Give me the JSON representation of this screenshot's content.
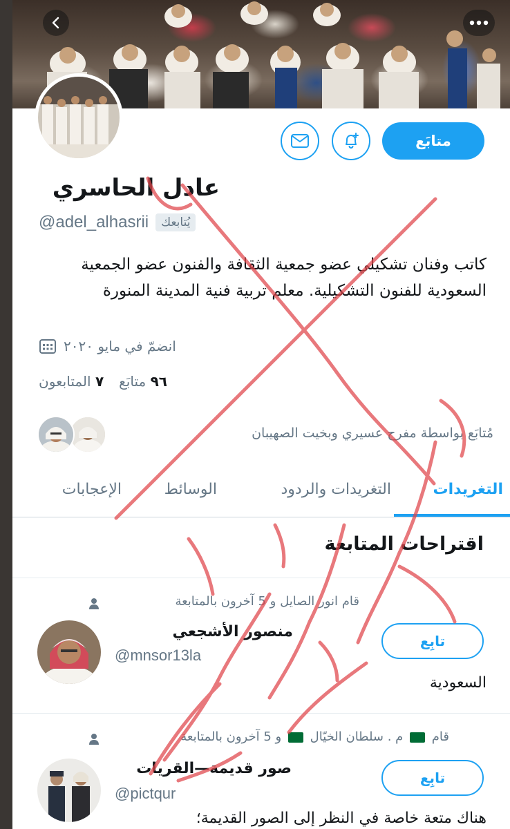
{
  "header": {
    "back_icon": "chevron-left-icon",
    "more_icon": "more-horizontal-icon"
  },
  "profile": {
    "name": "عادل الحاسري",
    "handle": "@adel_alhasrii",
    "follows_you_badge": "يُتابعك",
    "bio": "كاتب وفنان تشكيلي عضو جمعية الثقافة والفنون عضو الجمعية السعودية للفنون التشكيلية. معلم تربية فنية المدينة المنورة",
    "joined": "انضمّ في مايو ٢٠٢٠",
    "following_count": "٩٦",
    "following_label": "متابَع",
    "followers_count": "٧",
    "followers_label": "المتابعون",
    "followed_by": "مُتابَع بواسطة مفرح عسيري وبخيت الصهيبان",
    "follow_button": "متابَع"
  },
  "tabs": [
    {
      "label": "التغريدات",
      "active": true
    },
    {
      "label": "التغريدات والردود",
      "active": false
    },
    {
      "label": "الوسائط",
      "active": false
    },
    {
      "label": "الإعجابات",
      "active": false
    }
  ],
  "suggestions": {
    "title": "اقتراحات المتابعة",
    "items": [
      {
        "context": "قام انور الصايل و 5 آخرون بالمتابعة",
        "name": "منصور الأشجعي",
        "handle": "@mnsor13la",
        "follow_label": "تابِع",
        "bio": "السعودية"
      },
      {
        "context_start": "قام",
        "context_m": "م . سلطان الخيّال",
        "context_end": "و 5 آخرون بالمتابعة",
        "name": "صور قديمة—القريات",
        "handle": "@pictqur",
        "follow_label": "تابِع",
        "bio": "هناك متعة خاصة في النظر إلى الصور القديمة؛"
      }
    ]
  },
  "annotation": {
    "overlay": "red handwritten X with Arabic text"
  },
  "colors": {
    "accent": "#1da1f2",
    "secondary_text": "#657786",
    "overlay_red": "#e0454a",
    "flag_green": "#006c35"
  }
}
